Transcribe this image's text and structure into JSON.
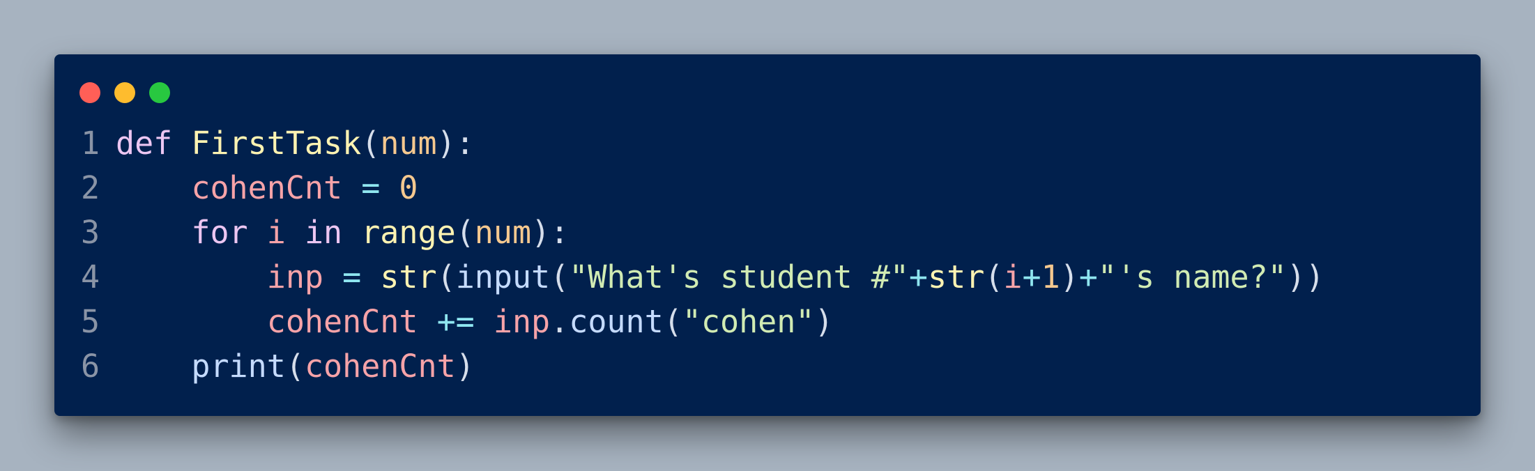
{
  "window": {
    "traffic_lights": [
      "close",
      "minimize",
      "maximize"
    ]
  },
  "colors": {
    "background": "#a7b3c0",
    "editor_background": "#01204d",
    "close": "#ff5f57",
    "minimize": "#febc2e",
    "maximize": "#28c840"
  },
  "code": {
    "language": "python",
    "lines": [
      {
        "number": "1",
        "tokens": [
          {
            "t": "def",
            "k": "kw"
          },
          {
            "t": " ",
            "k": "pn"
          },
          {
            "t": "FirstTask",
            "k": "fn"
          },
          {
            "t": "(",
            "k": "pn"
          },
          {
            "t": "num",
            "k": "param"
          },
          {
            "t": "):",
            "k": "pn"
          }
        ]
      },
      {
        "number": "2",
        "tokens": [
          {
            "t": "    ",
            "k": "pn"
          },
          {
            "t": "cohenCnt",
            "k": "var"
          },
          {
            "t": " ",
            "k": "pn"
          },
          {
            "t": "=",
            "k": "op"
          },
          {
            "t": " ",
            "k": "pn"
          },
          {
            "t": "0",
            "k": "num"
          }
        ]
      },
      {
        "number": "3",
        "tokens": [
          {
            "t": "    ",
            "k": "pn"
          },
          {
            "t": "for",
            "k": "kw"
          },
          {
            "t": " ",
            "k": "pn"
          },
          {
            "t": "i",
            "k": "var"
          },
          {
            "t": " ",
            "k": "pn"
          },
          {
            "t": "in",
            "k": "kw"
          },
          {
            "t": " ",
            "k": "pn"
          },
          {
            "t": "range",
            "k": "fn"
          },
          {
            "t": "(",
            "k": "pn"
          },
          {
            "t": "num",
            "k": "param"
          },
          {
            "t": "):",
            "k": "pn"
          }
        ]
      },
      {
        "number": "4",
        "tokens": [
          {
            "t": "        ",
            "k": "pn"
          },
          {
            "t": "inp",
            "k": "var"
          },
          {
            "t": " ",
            "k": "pn"
          },
          {
            "t": "=",
            "k": "op"
          },
          {
            "t": " ",
            "k": "pn"
          },
          {
            "t": "str",
            "k": "fn"
          },
          {
            "t": "(",
            "k": "pn"
          },
          {
            "t": "input",
            "k": "bi"
          },
          {
            "t": "(",
            "k": "pn"
          },
          {
            "t": "\"What's student #\"",
            "k": "str"
          },
          {
            "t": "+",
            "k": "op"
          },
          {
            "t": "str",
            "k": "fn"
          },
          {
            "t": "(",
            "k": "pn"
          },
          {
            "t": "i",
            "k": "var"
          },
          {
            "t": "+",
            "k": "op"
          },
          {
            "t": "1",
            "k": "num"
          },
          {
            "t": ")",
            "k": "pn"
          },
          {
            "t": "+",
            "k": "op"
          },
          {
            "t": "\"'s name?\"",
            "k": "str"
          },
          {
            "t": "))",
            "k": "pn"
          }
        ]
      },
      {
        "number": "5",
        "tokens": [
          {
            "t": "        ",
            "k": "pn"
          },
          {
            "t": "cohenCnt",
            "k": "var"
          },
          {
            "t": " ",
            "k": "pn"
          },
          {
            "t": "+=",
            "k": "op"
          },
          {
            "t": " ",
            "k": "pn"
          },
          {
            "t": "inp",
            "k": "var"
          },
          {
            "t": ".",
            "k": "pn"
          },
          {
            "t": "count",
            "k": "bi"
          },
          {
            "t": "(",
            "k": "pn"
          },
          {
            "t": "\"cohen\"",
            "k": "str"
          },
          {
            "t": ")",
            "k": "pn"
          }
        ]
      },
      {
        "number": "6",
        "tokens": [
          {
            "t": "    ",
            "k": "pn"
          },
          {
            "t": "print",
            "k": "bi"
          },
          {
            "t": "(",
            "k": "pn"
          },
          {
            "t": "cohenCnt",
            "k": "var"
          },
          {
            "t": ")",
            "k": "pn"
          }
        ]
      }
    ]
  }
}
